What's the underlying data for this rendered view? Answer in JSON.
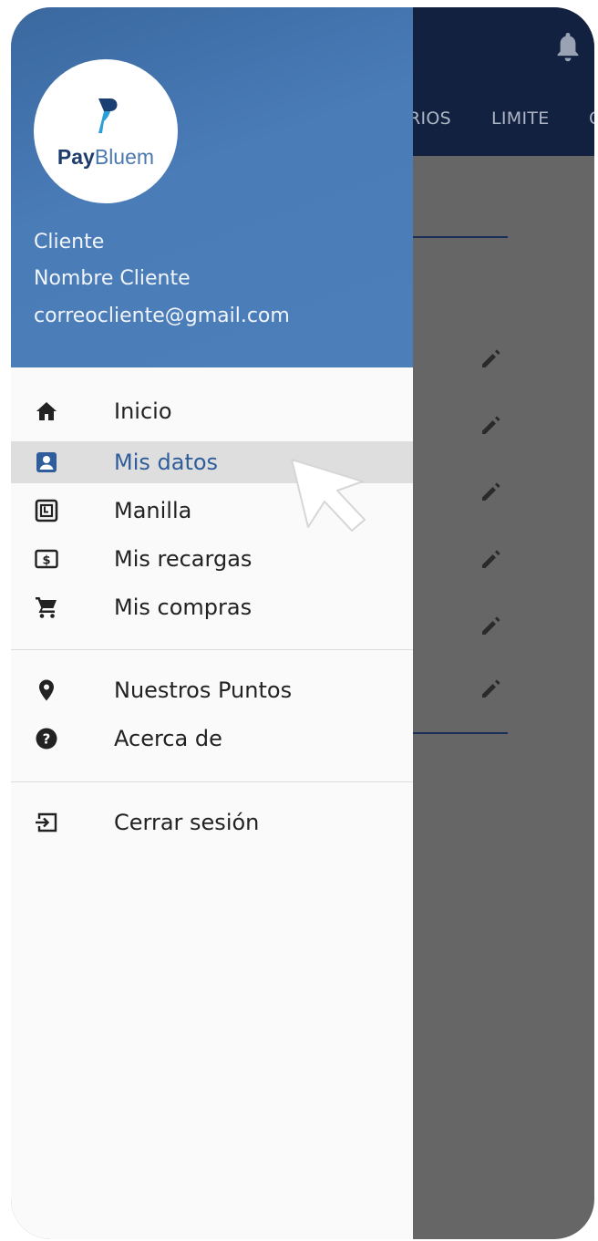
{
  "app_bar": {
    "tabs": [
      "RIOS",
      "LIMITE",
      "C"
    ]
  },
  "drawer": {
    "logo": {
      "brand_pay": "Pay",
      "brand_bluem": "Bluem"
    },
    "user": {
      "role": "Cliente",
      "name": "Nombre Cliente",
      "email": "correocliente@gmail.com"
    },
    "menu_primary": [
      {
        "label": "Inicio",
        "icon": "home-icon"
      },
      {
        "label": "Mis datos",
        "icon": "account-box-icon",
        "active": true
      },
      {
        "label": "Manilla",
        "icon": "wristband-icon"
      },
      {
        "label": "Mis recargas",
        "icon": "money-icon"
      },
      {
        "label": "Mis compras",
        "icon": "cart-icon"
      }
    ],
    "menu_secondary": [
      {
        "label": "Nuestros Puntos",
        "icon": "location-pin-icon"
      },
      {
        "label": "Acerca de",
        "icon": "help-icon"
      }
    ],
    "menu_footer": [
      {
        "label": "Cerrar sesión",
        "icon": "logout-icon"
      }
    ]
  },
  "colors": {
    "drawer_header": "#4a7cb8",
    "app_bar": "#12213f",
    "active_text": "#2f5d9b",
    "active_bg": "#dedede",
    "scrim": "#666666"
  }
}
